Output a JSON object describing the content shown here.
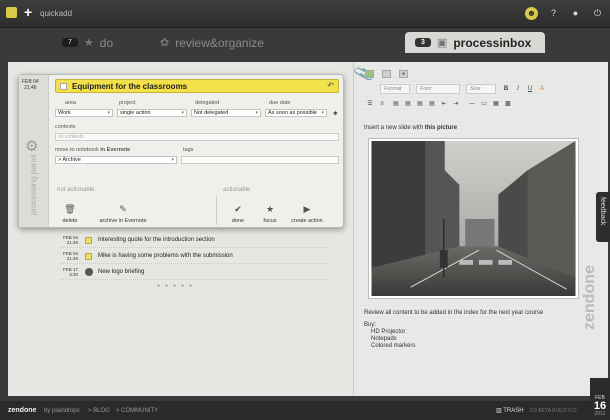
{
  "topbar": {
    "quickadd": "quickadd",
    "icons": [
      "bell-icon",
      "help-icon",
      "user-icon",
      "power-icon"
    ]
  },
  "tabs": [
    {
      "count": "7",
      "label": "do"
    },
    {
      "label": "review&organize"
    },
    {
      "count": "3",
      "label": "processinbox"
    }
  ],
  "panel": {
    "date_m": "FEB 04",
    "date_t": "21:46",
    "side_label": "processing panel",
    "title": "Equipment for the classrooms",
    "labels": {
      "area": "area",
      "project": "project",
      "delegated": "delegated",
      "due": "due date",
      "contexts": "contexts",
      "move": "move to notebook",
      "move_in": "in Evernote",
      "tags": "tags"
    },
    "values": {
      "area": "Work",
      "project": "single action",
      "delegated": "Not delegated",
      "due": "As soon as possible",
      "contexts": "no contexts",
      "notebook": "> Archive"
    },
    "not_actionable": "not actionable",
    "actionable": "actionable",
    "actions_left": [
      "delete",
      "archive in Evernote"
    ],
    "actions_right": [
      "done",
      "focus",
      "create action"
    ]
  },
  "inbox": [
    {
      "m": "FEB 04",
      "t": "21:46",
      "text": "Interesting quote for the introduction section",
      "kind": "task"
    },
    {
      "m": "FEB 04",
      "t": "21:46",
      "text": "Mike is having some problems with the submission",
      "kind": "task"
    },
    {
      "m": "FEB 17",
      "t": "3:30",
      "text": "New logo briefing",
      "kind": "evernote"
    }
  ],
  "editor": {
    "format": "Format",
    "font": "Font",
    "size": "Size",
    "bold": "B",
    "italic": "I",
    "underline": "U",
    "color": "A"
  },
  "note": {
    "intro_plain": "Insert a new slide with",
    "intro_bold": "this picture",
    "review": "Review all content to be added in the index for the next year course",
    "buy": "Buy:",
    "items": [
      "HD Projector",
      "Notepads",
      "Colored markers"
    ]
  },
  "feedback": "feedback",
  "brand_vertical": "zendone",
  "calendar": {
    "month": "FEB",
    "day": "16",
    "year": "2012"
  },
  "footer": {
    "brand": "zendone",
    "by": "by plaindrops",
    "blog": "> BLOG",
    "community": "> COMMUNITY",
    "trash": "TRASH",
    "build": "0.9 BETA BUILD 672"
  },
  "colors": {
    "accent": "#f2e14a",
    "dark": "#2d2d2d"
  }
}
